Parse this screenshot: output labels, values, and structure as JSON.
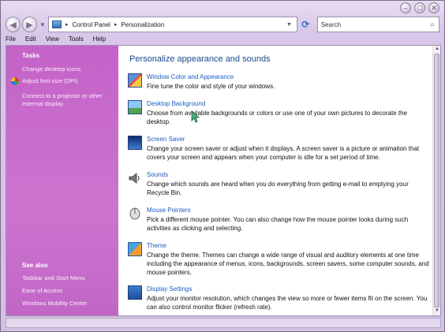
{
  "window": {
    "caption_minimize": "–",
    "caption_maximize": "□",
    "caption_close": "✕"
  },
  "address": {
    "back_glyph": "◀",
    "forward_glyph": "▶",
    "segments": [
      "Control Panel",
      "Personalization"
    ],
    "separator": "▸",
    "dropdown_glyph": "▼",
    "refresh_glyph": "⟳"
  },
  "search": {
    "placeholder": "Search",
    "icon": "magnifier-icon"
  },
  "menu": [
    "File",
    "Edit",
    "View",
    "Tools",
    "Help"
  ],
  "sidebar": {
    "tasks_title": "Tasks",
    "tasks": [
      "Change desktop icons",
      "Adjust font size (DPI)",
      "Connect to a projector or other external display"
    ],
    "see_also_title": "See also",
    "see_also": [
      "Taskbar and Start Menu",
      "Ease of Access",
      "Windows Mobility Center"
    ]
  },
  "main": {
    "heading": "Personalize appearance and sounds",
    "items": [
      {
        "title": "Window Color and Appearance",
        "desc": "Fine tune the color and style of your windows.",
        "icon": "window-color-icon"
      },
      {
        "title": "Desktop Background",
        "desc": "Choose from available backgrounds or colors or use one of your own pictures to decorate the desktop.",
        "icon": "desktop-background-icon"
      },
      {
        "title": "Screen Saver",
        "desc": "Change your screen saver or adjust when it displays. A screen saver is a picture or animation that covers your screen and appears when your computer is idle for a set period of time.",
        "icon": "screen-saver-icon"
      },
      {
        "title": "Sounds",
        "desc": "Change which sounds are heard when you do everything from getting e-mail to emptying your Recycle Bin.",
        "icon": "sounds-icon"
      },
      {
        "title": "Mouse Pointers",
        "desc": "Pick a different mouse pointer. You can also change how the mouse pointer looks during such activities as clicking and selecting.",
        "icon": "mouse-pointer-icon"
      },
      {
        "title": "Theme",
        "desc": "Change the theme. Themes can change a wide range of visual and auditory elements at one time including the appearance of menus, icons, backgrounds, screen savers, some computer sounds, and mouse pointers.",
        "icon": "theme-icon"
      },
      {
        "title": "Display Settings",
        "desc": "Adjust your monitor resolution, which changes the view so more or fewer items fit on the screen. You can also control monitor flicker (refresh rate).",
        "icon": "display-settings-icon"
      }
    ]
  }
}
